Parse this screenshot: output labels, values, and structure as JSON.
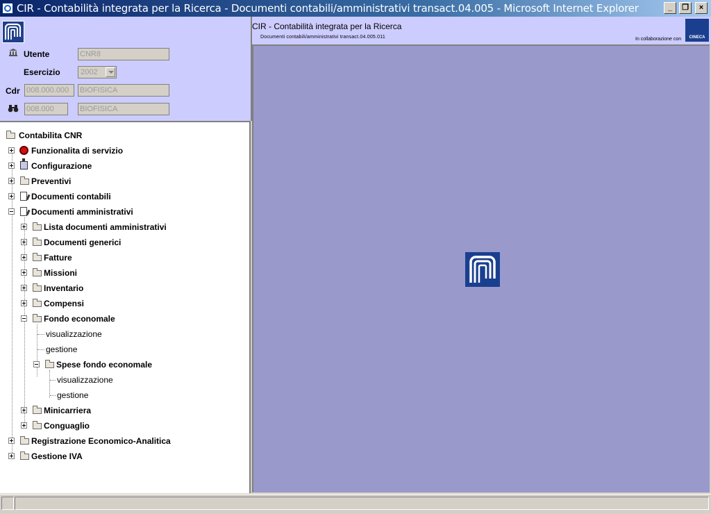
{
  "window": {
    "title": "CIR - Contabilità integrata per la Ricerca - Documenti contabili/amministrativi transact.04.005 - Microsoft Internet Explorer",
    "controls": {
      "minimize": "_",
      "restore": "❐",
      "close": "×"
    }
  },
  "info": {
    "utente_label": "Utente",
    "utente_value": "CNR8",
    "esercizio_label": "Esercizio",
    "esercizio_value": "2002",
    "cdr_label": "Cdr",
    "cdr_code": "008.000.000",
    "cdr_name": "BIOFISICA",
    "uo_code": "008.000",
    "uo_name": "BIOFISICA"
  },
  "header": {
    "title": "CIR - Contabilità integrata per la Ricerca",
    "subtitle": "Documenti contabili/amministrativi transact.04.005.011",
    "collaboration": "In collaborazione con",
    "partner_logo": "CINECA"
  },
  "tree": {
    "root": "Contabilita CNR",
    "items": [
      {
        "label": "Funzionalita di servizio",
        "bold": true
      },
      {
        "label": "Configurazione",
        "bold": true
      },
      {
        "label": "Preventivi",
        "bold": true
      },
      {
        "label": "Documenti contabili",
        "bold": true
      },
      {
        "label": "Documenti amministrativi",
        "bold": true
      },
      {
        "label": "Lista documenti amministrativi",
        "bold": true
      },
      {
        "label": "Documenti generici",
        "bold": true
      },
      {
        "label": "Fatture",
        "bold": true
      },
      {
        "label": "Missioni",
        "bold": true
      },
      {
        "label": "Inventario",
        "bold": true
      },
      {
        "label": "Compensi",
        "bold": true
      },
      {
        "label": "Fondo economale",
        "bold": true
      },
      {
        "label": "visualizzazione",
        "bold": false
      },
      {
        "label": "gestione",
        "bold": false
      },
      {
        "label": "Spese fondo economale",
        "bold": true
      },
      {
        "label": "visualizzazione",
        "bold": false
      },
      {
        "label": "gestione",
        "bold": false
      },
      {
        "label": "Minicarriera",
        "bold": true
      },
      {
        "label": "Conguaglio",
        "bold": true
      },
      {
        "label": "Registrazione Economico-Analitica",
        "bold": true
      },
      {
        "label": "Gestione IVA",
        "bold": true
      }
    ]
  }
}
